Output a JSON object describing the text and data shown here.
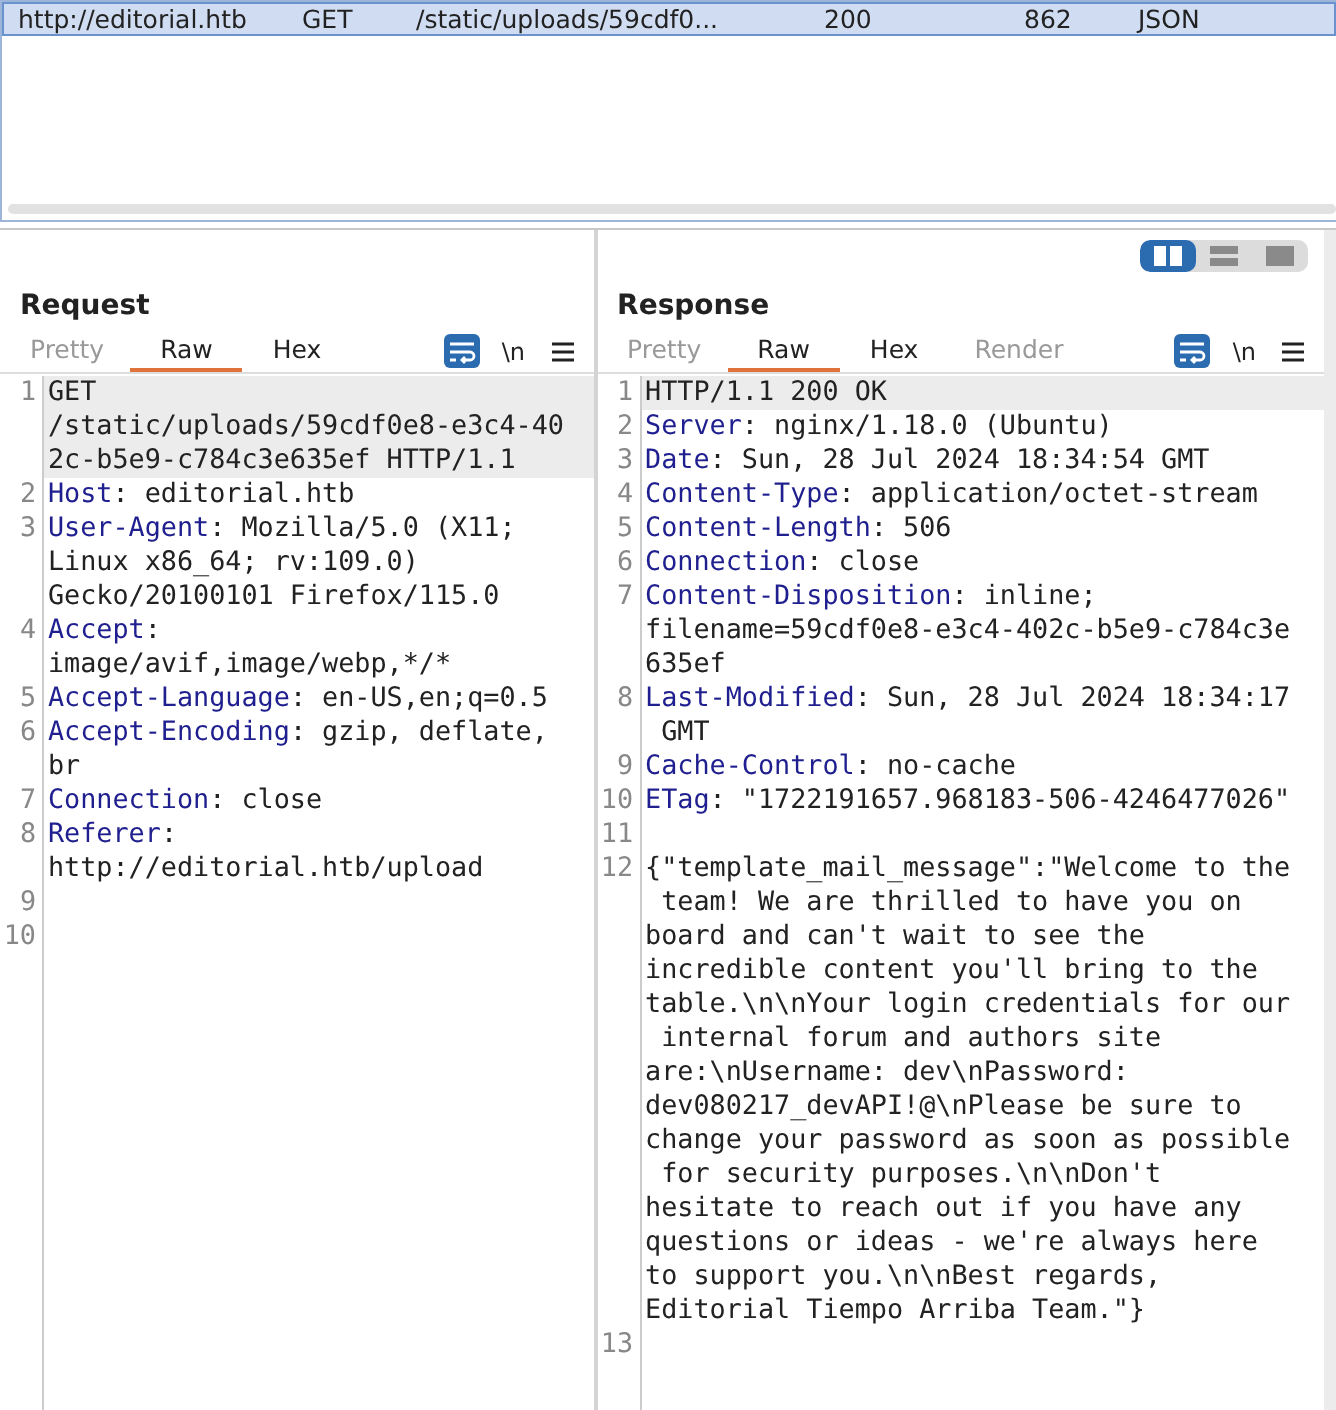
{
  "history": {
    "rows": [
      {
        "selected": true,
        "cells": [
          "http://editorial.htb",
          "GET",
          "/static/uploads/59cdf0...",
          "200",
          "862",
          "JSON"
        ]
      }
    ]
  },
  "layout_toggles": [
    {
      "kind": "columns",
      "selected": true
    },
    {
      "kind": "rows",
      "selected": false
    },
    {
      "kind": "single",
      "selected": false
    }
  ],
  "panels": [
    {
      "title": "Request",
      "tabs": [
        {
          "label": "Pretty",
          "selected": false,
          "disabled": true
        },
        {
          "label": "Raw",
          "selected": true,
          "disabled": false
        },
        {
          "label": "Hex",
          "selected": false,
          "disabled": false
        }
      ],
      "toolbar": {
        "wrap_on": true,
        "newline_label": "\\n"
      },
      "lines": [
        {
          "number": "1",
          "current": true,
          "rows": [
            "GET",
            "/static/uploads/59cdf0e8-e3c4-40",
            "2c-b5e9-c784c3e635ef HTTP/1.1"
          ]
        },
        {
          "number": "2",
          "current": false,
          "name": "Host",
          "rows": [
            ": editorial.htb"
          ]
        },
        {
          "number": "3",
          "current": false,
          "name": "User-Agent",
          "rows": [
            ": Mozilla/5.0 (X11;",
            "Linux x86_64; rv:109.0)",
            "Gecko/20100101 Firefox/115.0"
          ]
        },
        {
          "number": "4",
          "current": false,
          "name": "Accept",
          "rows": [
            ":",
            "image/avif,image/webp,*/*"
          ]
        },
        {
          "number": "5",
          "current": false,
          "name": "Accept-Language",
          "rows": [
            ": en-US,en;q=0.5"
          ]
        },
        {
          "number": "6",
          "current": false,
          "name": "Accept-Encoding",
          "rows": [
            ": gzip, deflate,",
            "br"
          ]
        },
        {
          "number": "7",
          "current": false,
          "name": "Connection",
          "rows": [
            ": close"
          ]
        },
        {
          "number": "8",
          "current": false,
          "name": "Referer",
          "rows": [
            ":",
            "http://editorial.htb/upload"
          ]
        },
        {
          "number": "9",
          "current": false
        },
        {
          "number": "10",
          "current": false
        }
      ]
    },
    {
      "title": "Response",
      "tabs": [
        {
          "label": "Pretty",
          "selected": false,
          "disabled": true
        },
        {
          "label": "Raw",
          "selected": true,
          "disabled": false
        },
        {
          "label": "Hex",
          "selected": false,
          "disabled": false
        },
        {
          "label": "Render",
          "selected": false,
          "disabled": true
        }
      ],
      "toolbar": {
        "wrap_on": true,
        "newline_label": "\\n"
      },
      "lines": [
        {
          "number": "1",
          "current": true,
          "rows": [
            "HTTP/1.1 200 OK"
          ]
        },
        {
          "number": "2",
          "current": false,
          "name": "Server",
          "rows": [
            ": nginx/1.18.0 (Ubuntu)"
          ]
        },
        {
          "number": "3",
          "current": false,
          "name": "Date",
          "rows": [
            ": Sun, 28 Jul 2024 18:34:54 GMT"
          ]
        },
        {
          "number": "4",
          "current": false,
          "name": "Content-Type",
          "rows": [
            ": application/octet-stream"
          ]
        },
        {
          "number": "5",
          "current": false,
          "name": "Content-Length",
          "rows": [
            ": 506"
          ]
        },
        {
          "number": "6",
          "current": false,
          "name": "Connection",
          "rows": [
            ": close"
          ]
        },
        {
          "number": "7",
          "current": false,
          "name": "Content-Disposition",
          "rows": [
            ": inline;",
            "filename=59cdf0e8-e3c4-402c-b5e9-c784c3e",
            "635ef"
          ]
        },
        {
          "number": "8",
          "current": false,
          "name": "Last-Modified",
          "rows": [
            ": Sun, 28 Jul 2024 18:34:17",
            " GMT"
          ]
        },
        {
          "number": "9",
          "current": false,
          "name": "Cache-Control",
          "rows": [
            ": no-cache"
          ]
        },
        {
          "number": "10",
          "current": false,
          "name": "ETag",
          "rows": [
            ": \"1722191657.968183-506-4246477026\""
          ]
        },
        {
          "number": "11",
          "current": false
        },
        {
          "number": "12",
          "current": false,
          "rows": [
            "{\"template_mail_message\":\"Welcome to the",
            " team! We are thrilled to have you on",
            "board and can't wait to see the",
            "incredible content you'll bring to the",
            "table.\\n\\nYour login credentials for our",
            " internal forum and authors site",
            "are:\\nUsername: dev\\nPassword:",
            "dev080217_devAPI!@\\nPlease be sure to",
            "change your password as soon as possible",
            " for security purposes.\\n\\nDon't",
            "hesitate to reach out if you have any",
            "questions or ideas - we're always here",
            "to support you.\\n\\nBest regards,",
            "Editorial Tiempo Arriba Team.\"}"
          ]
        },
        {
          "number": "13",
          "current": false
        }
      ]
    }
  ]
}
